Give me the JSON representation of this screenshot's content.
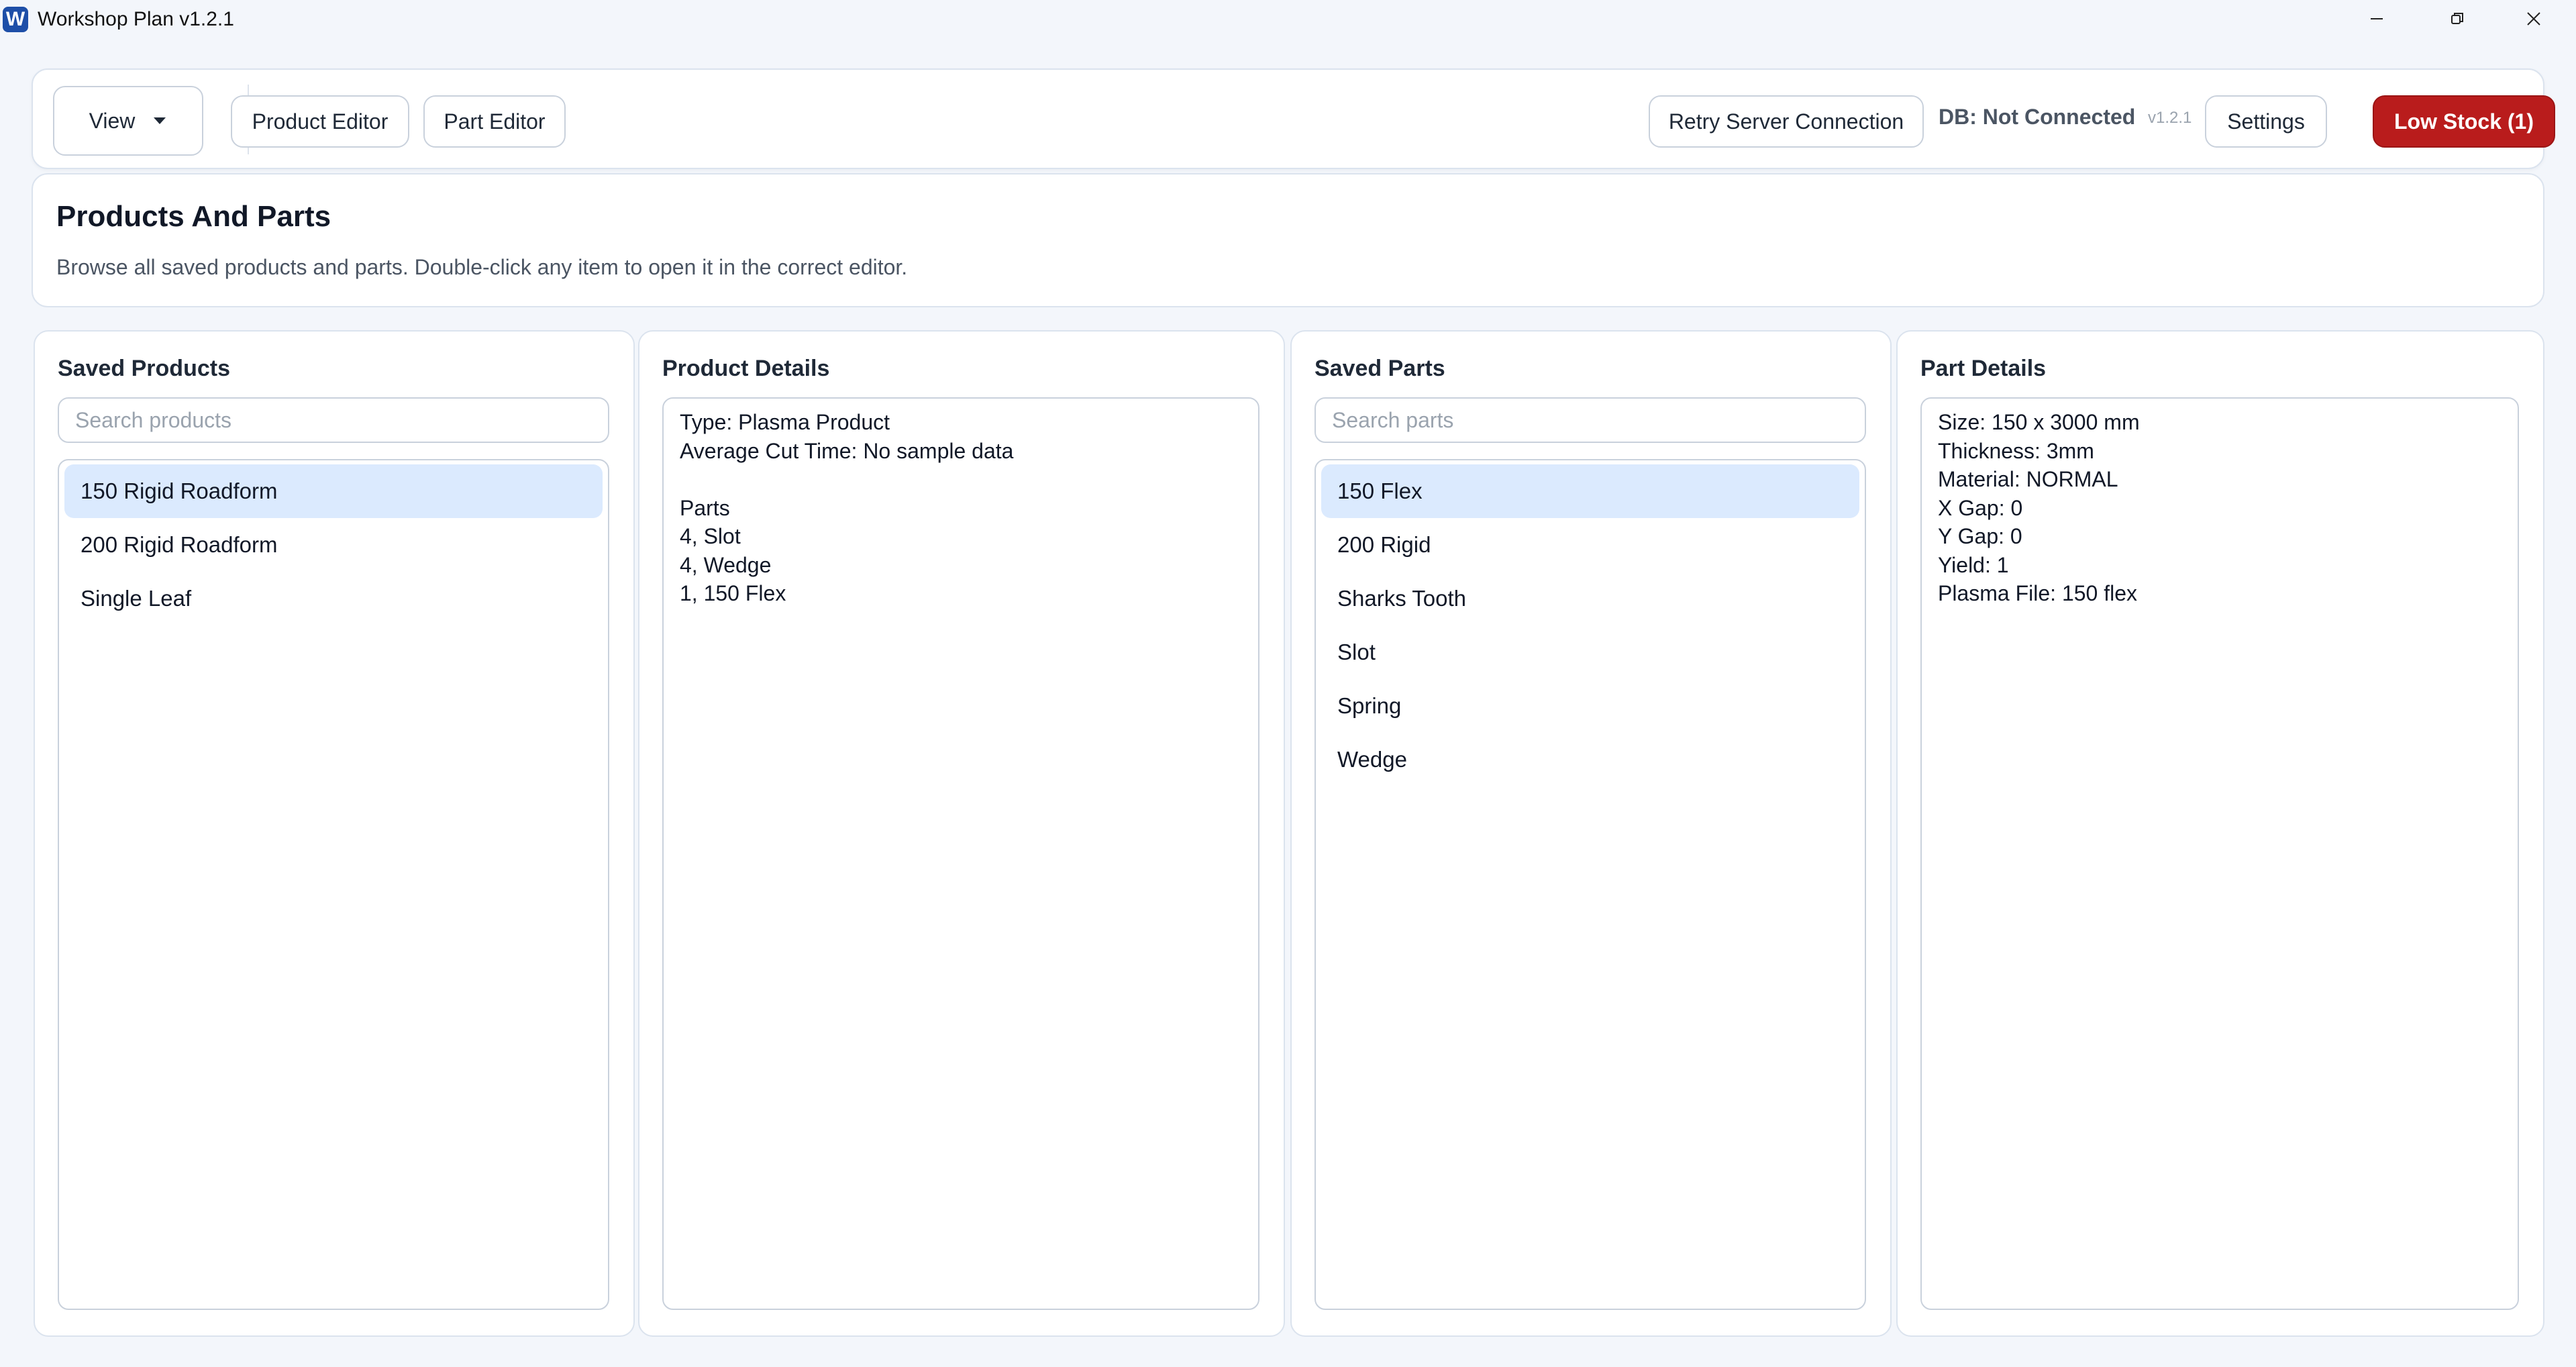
{
  "window": {
    "title": "Workshop Plan v1.2.1",
    "icon_letter": "W",
    "controls": [
      "minimize-icon",
      "restore-icon",
      "close-icon"
    ]
  },
  "toolbar": {
    "view_label": "View",
    "product_editor_label": "Product Editor",
    "part_editor_label": "Part Editor",
    "retry_label": "Retry Server Connection",
    "db_status": "DB: Not Connected",
    "version": "v1.2.1",
    "settings_label": "Settings",
    "low_stock_label": "Low Stock (1)"
  },
  "header": {
    "title": "Products And Parts",
    "description": "Browse all saved products and parts. Double-click any item to open it in the correct editor."
  },
  "saved_products": {
    "title": "Saved Products",
    "search_placeholder": "Search products",
    "items": [
      "150 Rigid Roadform",
      "200 Rigid Roadform",
      "Single Leaf"
    ],
    "selected_index": 0
  },
  "product_details": {
    "title": "Product Details",
    "lines": [
      "Type: Plasma Product",
      "Average Cut Time: No sample data",
      "",
      "Parts",
      "4, Slot",
      "4, Wedge",
      "1, 150 Flex"
    ]
  },
  "saved_parts": {
    "title": "Saved Parts",
    "search_placeholder": "Search parts",
    "items": [
      "150 Flex",
      "200 Rigid",
      "Sharks Tooth",
      "Slot",
      "Spring",
      "Wedge"
    ],
    "selected_index": 0
  },
  "part_details": {
    "title": "Part Details",
    "lines": [
      "Size: 150 x 3000 mm",
      "Thickness: 3mm",
      "Material: NORMAL",
      "X Gap: 0",
      "Y Gap: 0",
      "Yield: 1",
      "Plasma File: 150 flex"
    ]
  },
  "colors": {
    "accent_selected": "#dbeafe",
    "low_stock": "#b91c1c",
    "app_icon": "#1e4fa8"
  }
}
